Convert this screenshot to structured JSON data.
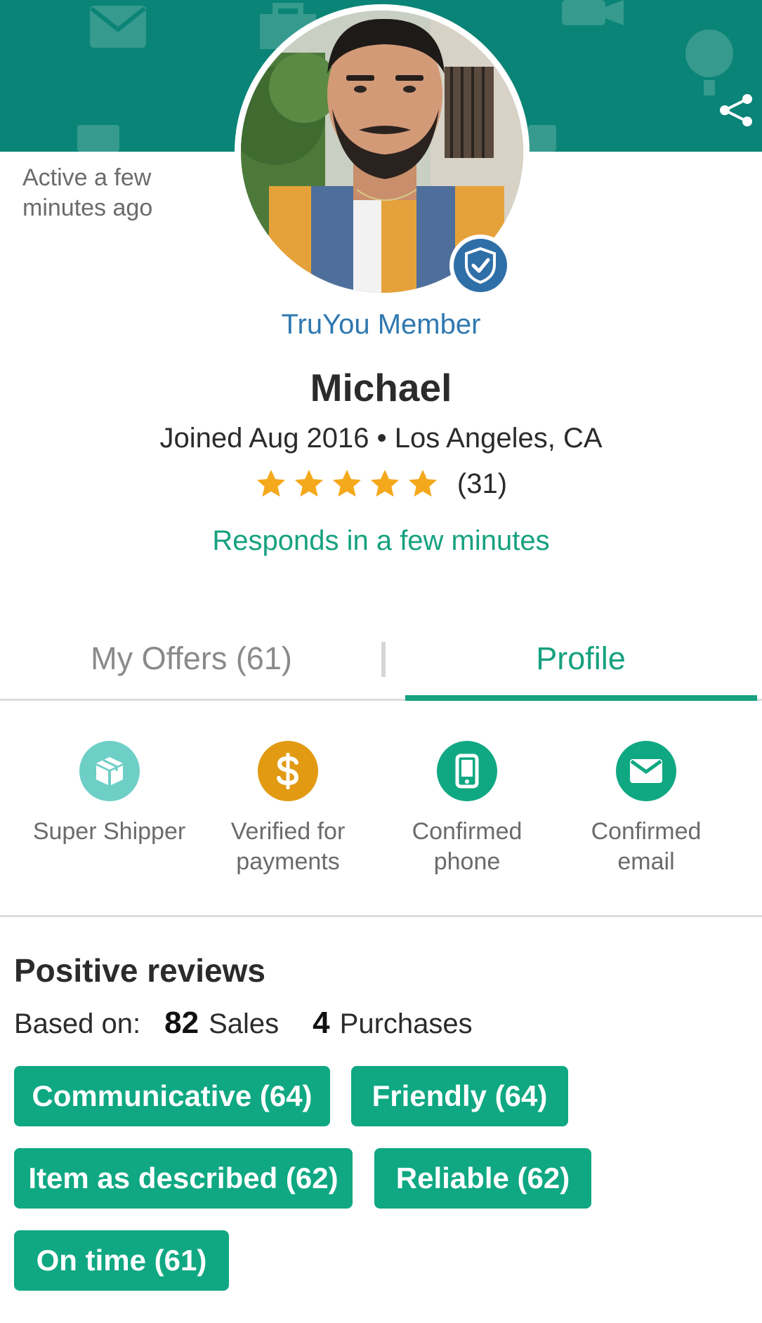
{
  "header": {
    "share_icon": "share-icon",
    "banner_color": "#0a8476"
  },
  "profile": {
    "activity": "Active a few minutes ago",
    "membership": "TruYou Member",
    "name": "Michael",
    "joined": "Joined Aug 2016 • Los Angeles, CA",
    "rating": 5,
    "rating_count": "(31)",
    "responds": "Responds in a few minutes",
    "verified_badge_icon": "shield-check-icon"
  },
  "tabs": [
    {
      "label": "My Offers (61)",
      "active": false
    },
    {
      "label": "Profile",
      "active": true
    }
  ],
  "badges": [
    {
      "label": "Super Shipper",
      "icon": "box-icon",
      "color": "#6ecfc7"
    },
    {
      "label": "Verified for payments",
      "icon": "dollar-icon",
      "color": "#e19a12"
    },
    {
      "label": "Confirmed phone",
      "icon": "phone-icon",
      "color": "#0fa882"
    },
    {
      "label": "Confirmed email",
      "icon": "envelope-icon",
      "color": "#0fa882"
    }
  ],
  "reviews": {
    "title": "Positive reviews",
    "based_on_label": "Based on:",
    "sales_count": "82",
    "sales_label": "Sales",
    "purchases_count": "4",
    "purchases_label": "Purchases",
    "tags": [
      "Communicative (64)",
      "Friendly (64)",
      "Item as described (62)",
      "Reliable (62)",
      "On time (61)"
    ]
  },
  "colors": {
    "accent": "#16a17f",
    "link_blue": "#2f78b0",
    "star": "#f4a81c"
  }
}
